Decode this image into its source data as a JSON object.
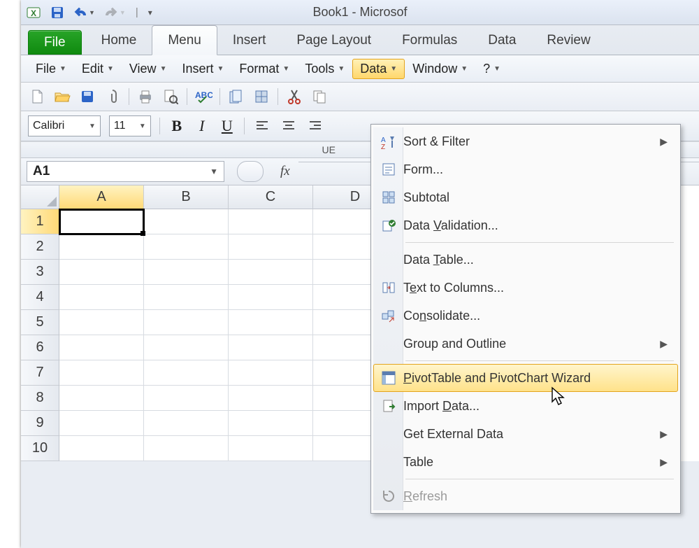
{
  "app": {
    "title": "Book1 - Microsof"
  },
  "qat": {
    "save": "save-icon",
    "undo": "undo-icon",
    "redo": "redo-icon"
  },
  "ribbon": {
    "file": "File",
    "tabs": [
      "Home",
      "Menu",
      "Insert",
      "Page Layout",
      "Formulas",
      "Data",
      "Review"
    ],
    "active": "Menu"
  },
  "menubar": {
    "items": [
      "File",
      "Edit",
      "View",
      "Insert",
      "Format",
      "Tools",
      "Data",
      "Window",
      "?"
    ],
    "active": "Data"
  },
  "format": {
    "font": "Calibri",
    "size": "11",
    "bold": "B",
    "italic": "I",
    "underline": "U"
  },
  "ubit": "UE",
  "namebox": {
    "value": "A1"
  },
  "fx_label": "fx",
  "grid": {
    "cols": [
      "A",
      "B",
      "C",
      "D"
    ],
    "rows": [
      "1",
      "2",
      "3",
      "4",
      "5",
      "6",
      "7",
      "8",
      "9",
      "10"
    ],
    "active_cell": "A1"
  },
  "data_menu": {
    "items": [
      {
        "label": "Sort & Filter",
        "submenu": true,
        "icon": "sort-filter"
      },
      {
        "label": "Form...",
        "icon": "form"
      },
      {
        "label": "Subtotal",
        "icon": "subtotal"
      },
      {
        "label": "Data Validation...",
        "ak": "V",
        "icon": "validation"
      },
      {
        "sep": true
      },
      {
        "label": "Data Table...",
        "ak": "T",
        "icon": ""
      },
      {
        "label": "Text to Columns...",
        "ak": "e",
        "icon": "text-to-columns"
      },
      {
        "label": "Consolidate...",
        "ak": "n",
        "icon": "consolidate"
      },
      {
        "label": "Group and Outline",
        "submenu": true,
        "icon": ""
      },
      {
        "sep": true
      },
      {
        "label": "PivotTable and PivotChart Wizard",
        "ak": "P",
        "icon": "pivot",
        "highlight": true
      },
      {
        "label": "Import Data...",
        "ak": "D",
        "icon": "import"
      },
      {
        "label": "Get External Data",
        "submenu": true,
        "icon": ""
      },
      {
        "label": "Table",
        "submenu": true,
        "icon": ""
      },
      {
        "sep": true
      },
      {
        "label": "Refresh",
        "ak": "R",
        "icon": "refresh",
        "disabled": true
      }
    ]
  }
}
